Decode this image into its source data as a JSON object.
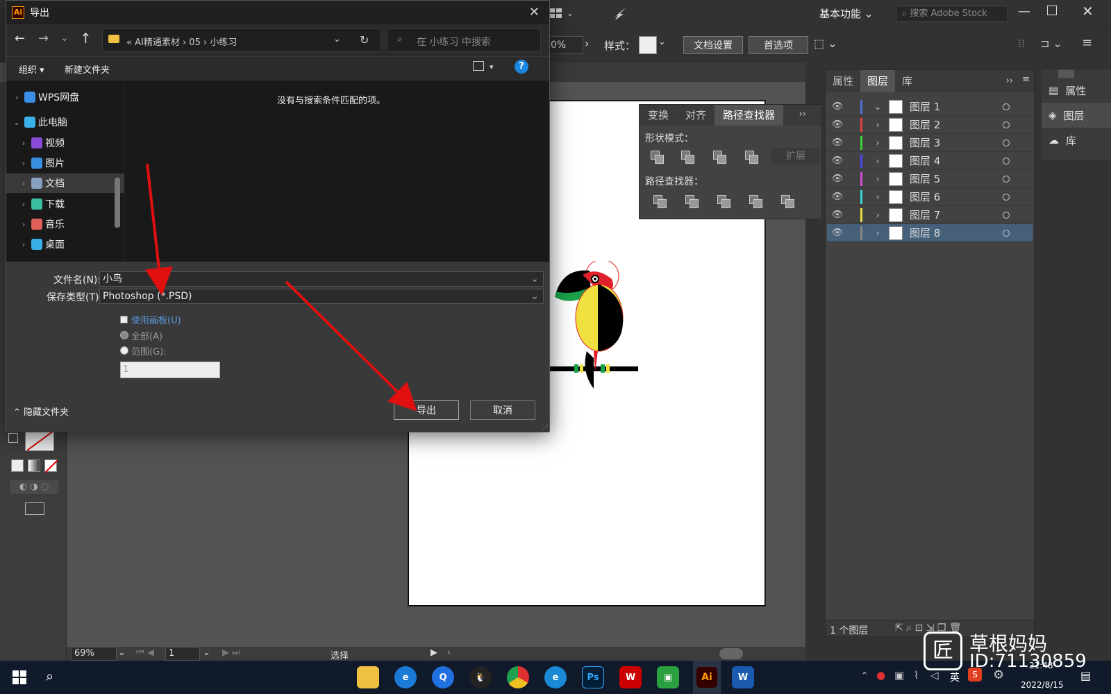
{
  "illustrator": {
    "workspace": "基本功能",
    "stock_search_placeholder": "搜索 Adobe Stock",
    "ctrl": {
      "zoom_fragment": "0%",
      "style_label": "样式：",
      "doc_setup": "文档设置",
      "prefs": "首选项"
    },
    "status": {
      "zoom": "69%",
      "page": "1",
      "tool": "选择"
    },
    "pathfinder": {
      "tabs": [
        "变换",
        "对齐",
        "路径查找器"
      ],
      "shape_modes_label": "形状模式：",
      "expand_label": "扩展",
      "pathfinders_label": "路径查找器："
    },
    "layers_panel": {
      "tabs": [
        "属性",
        "图层",
        "库"
      ],
      "layers": [
        {
          "name": "图层 1",
          "color": "#4f6fd6"
        },
        {
          "name": "图层 2",
          "color": "#e04040"
        },
        {
          "name": "图层 3",
          "color": "#3ad43a"
        },
        {
          "name": "图层 4",
          "color": "#4848e8"
        },
        {
          "name": "图层 5",
          "color": "#d44ad4"
        },
        {
          "name": "图层 6",
          "color": "#3ad6d6"
        },
        {
          "name": "图层 7",
          "color": "#e8e040"
        },
        {
          "name": "图层 8",
          "color": "#888888"
        }
      ],
      "footer": "1 个图层"
    },
    "mini_dock": [
      "属性",
      "图层",
      "库"
    ]
  },
  "dialog": {
    "title": "导出",
    "breadcrumb": [
      "AI精通素材",
      "05",
      "小练习"
    ],
    "search_placeholder": "在 小练习 中搜索",
    "cmd": {
      "organize": "组织",
      "new_folder": "新建文件夹"
    },
    "tree": [
      {
        "label": "WPS网盘",
        "icon": "cloud-icon",
        "color": "#3b8fe8"
      },
      {
        "label": "此电脑",
        "icon": "computer-icon",
        "color": "#3ab0e8"
      },
      {
        "label": "视频",
        "icon": "video-icon",
        "color": "#8a4ad8"
      },
      {
        "label": "图片",
        "icon": "pictures-icon",
        "color": "#3a8ee0"
      },
      {
        "label": "文档",
        "icon": "documents-icon",
        "color": "#8aa0c0"
      },
      {
        "label": "下载",
        "icon": "download-icon",
        "color": "#3ac0a0"
      },
      {
        "label": "音乐",
        "icon": "music-icon",
        "color": "#e0605a"
      },
      {
        "label": "桌面",
        "icon": "desktop-icon",
        "color": "#3ab0e8"
      }
    ],
    "empty_message": "没有与搜索条件匹配的项。",
    "filename_label": "文件名(N):",
    "filename_value": "小鸟",
    "filetype_label": "保存类型(T):",
    "filetype_value": "Photoshop (*.PSD)",
    "use_artboards": "使用画板(U)",
    "all_label": "全部(A)",
    "range_label": "范围(G):",
    "range_value": "1",
    "hide_folders": "隐藏文件夹",
    "export_btn": "导出",
    "cancel_btn": "取消"
  },
  "taskbar": {
    "time": "21:48",
    "date": "2022/8/15",
    "lang": "英"
  },
  "watermark": {
    "name": "草根妈妈",
    "id": "ID:71130859"
  }
}
